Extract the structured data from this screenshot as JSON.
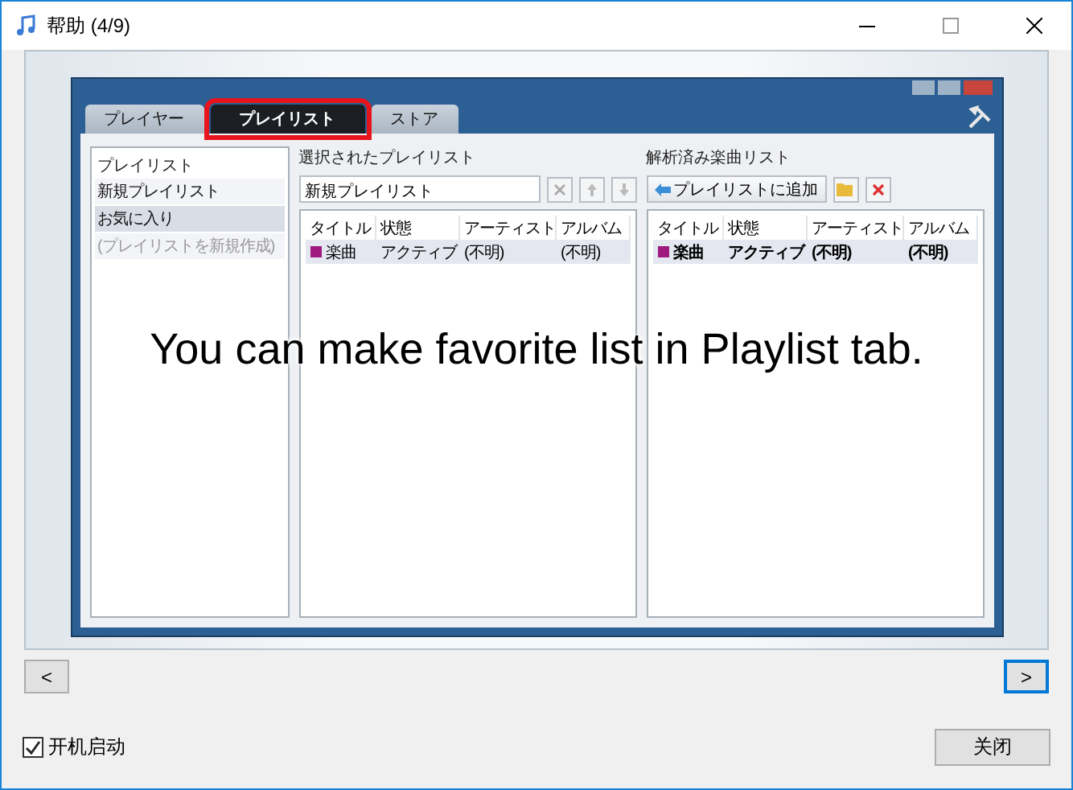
{
  "window": {
    "title": "帮助 (4/9)"
  },
  "slide": {
    "caption": "You can make favorite list in Playlist tab.",
    "app": {
      "tabs": [
        {
          "label": "プレイヤー",
          "selected": false,
          "highlighted": false
        },
        {
          "label": "プレイリスト",
          "selected": true,
          "highlighted": true
        },
        {
          "label": "ストア",
          "selected": false,
          "highlighted": false
        }
      ],
      "sidebar": {
        "header": "プレイリスト",
        "items": [
          {
            "label": "新規プレイリスト",
            "selected": false,
            "disabled": false
          },
          {
            "label": "お気に入り",
            "selected": true,
            "disabled": false
          },
          {
            "label": "(プレイリストを新規作成)",
            "selected": false,
            "disabled": true
          }
        ]
      },
      "selected_playlist": {
        "label": "選択されたプレイリスト",
        "name_field": "新規プレイリスト",
        "columns": [
          "タイトル",
          "状態",
          "アーティスト",
          "アルバム"
        ],
        "rows": [
          {
            "cells": [
              "楽曲",
              "アクティブ",
              "(不明)",
              "(不明)"
            ],
            "color": "#a0197f",
            "selected": true,
            "bold": false
          }
        ]
      },
      "analyzed_list": {
        "label": "解析済み楽曲リスト",
        "add_button": "プレイリストに追加",
        "columns": [
          "タイトル",
          "状態",
          "アーティスト",
          "アルバム"
        ],
        "rows": [
          {
            "cells": [
              "楽曲",
              "アクティブ",
              "(不明)",
              "(不明)"
            ],
            "color": "#a0197f",
            "selected": true,
            "bold": true
          }
        ]
      }
    }
  },
  "nav": {
    "prev": "<",
    "next": ">",
    "next_focused": true
  },
  "footer": {
    "autostart": {
      "label": "开机启动",
      "checked": true
    },
    "close_button": "关闭"
  }
}
